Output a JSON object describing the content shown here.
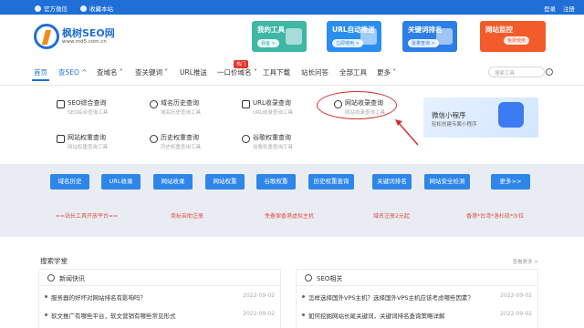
{
  "topbar": {
    "wechat": "官方微信",
    "bookmark": "收藏本站",
    "login": "登录",
    "register": "注册"
  },
  "logo": {
    "name": "枫树SEO网",
    "url": "www.md5.com.cn"
  },
  "banners": [
    {
      "title": "我的工具",
      "btn": "我备 >",
      "color": "#3fb7a6"
    },
    {
      "title": "URL自动推送",
      "btn": "立即使用 >",
      "color": "#2a8ef0"
    },
    {
      "title": "关键词排名",
      "btn": "批量查询 >",
      "color": "#2d7ee8"
    },
    {
      "title": "网站监控",
      "btn": "免费使用",
      "color": "#f25c2a"
    }
  ],
  "nav": {
    "items": [
      "首页",
      "查SEO",
      "查域名",
      "查关键词",
      "URL推送",
      "一口价域名",
      "工具下载",
      "站长问答",
      "全部工具",
      "更多"
    ],
    "hot_badge": "热门",
    "search_placeholder": "搜索工具"
  },
  "dropdown": [
    {
      "title": "SEO综合查询",
      "sub": "SEO综合查询工具"
    },
    {
      "title": "域名历史查询",
      "sub": "域名历史查询工具"
    },
    {
      "title": "URL收录查询",
      "sub": "URL收录查询工具"
    },
    {
      "title": "网站收录查询",
      "sub": "网站收录查询工具"
    },
    {
      "title": "网站权重查询",
      "sub": "网站权重查询工具"
    },
    {
      "title": "历史权重查询",
      "sub": "历史权重查询工具"
    },
    {
      "title": "谷歌权重查询",
      "sub": "谷歌权重查询工具"
    }
  ],
  "miniprogram": {
    "title": "微信小程序",
    "sub": "轻松创建专属小程序"
  },
  "quick_buttons": [
    "域名历史",
    "URL收录",
    "网站收录",
    "网站权重",
    "谷歌权重",
    "历史权重查询",
    "关键词排名",
    "网站安全检测",
    "更多>>"
  ],
  "promo_links": [
    "==站长工具开放平台==",
    "商标自助注册",
    "免备案香港虚拟主机",
    "域名注册2元起",
    "香港*台湾*洛杉矶*沙拉"
  ],
  "search_section": {
    "title": "搜索学堂",
    "more": "查看更多 >"
  },
  "panels": [
    {
      "title": "新闻快讯",
      "rows": [
        {
          "text": "服务器的好坏对网站排名有影响吗？",
          "date": "2022-09-02"
        },
        {
          "text": "软文推广有哪些平台，软文营销有哪些常见形式",
          "date": "2022-09-02"
        }
      ]
    },
    {
      "title": "SEO相关",
      "rows": [
        {
          "text": "怎样选择国外VPS主机？选择国外VPS主机应该考虑哪些因素？",
          "date": "2022-09-02"
        },
        {
          "text": "如何挖掘网站长尾关键词，关键词排名查询策略详解",
          "date": "2022-09-02"
        }
      ]
    }
  ],
  "colors": {
    "primary": "#1f6fd6",
    "accent": "#f08a1c",
    "alert": "#d3302b",
    "button": "#2e86e8"
  }
}
